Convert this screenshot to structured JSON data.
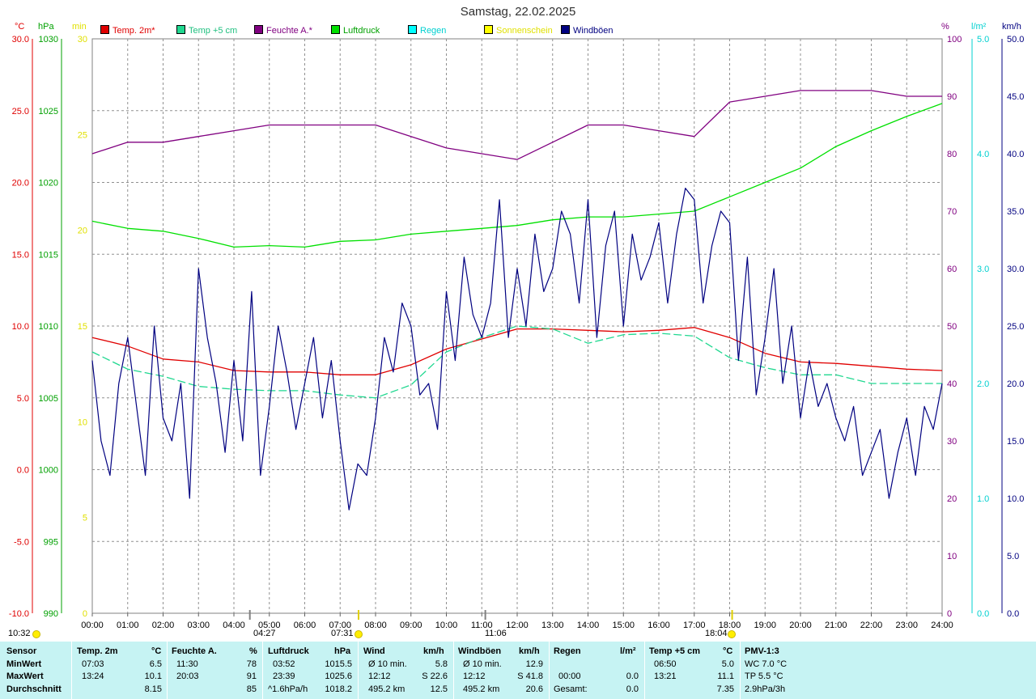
{
  "title": "Samstag, 22.02.2025",
  "axis_headers": {
    "degc": "°C",
    "hpa": "hPa",
    "min": "min",
    "pct": "%",
    "rain": "l/m²",
    "kmh": "km/h"
  },
  "legend": [
    {
      "label": "Temp. 2m*",
      "color": "#e00000",
      "text_color": "#e00000"
    },
    {
      "label": "Temp +5 cm",
      "color": "#20d890",
      "text_color": "#20c080"
    },
    {
      "label": "Feuchte A.*",
      "color": "#800080",
      "text_color": "#800080"
    },
    {
      "label": "Luftdruck",
      "color": "#00e000",
      "text_color": "#00a000"
    },
    {
      "label": "Regen",
      "color": "#00ffff",
      "text_color": "#00d0d0"
    },
    {
      "label": "Sonnenschein",
      "color": "#ffff00",
      "text_color": "#e0e000"
    },
    {
      "label": "Windböen",
      "color": "#000080",
      "text_color": "#000080"
    }
  ],
  "markers": {
    "sunrise": "07:31",
    "sunset": "18:04",
    "low_time": "04:27",
    "mid_time": "11:06",
    "top_left_time": "10:32"
  },
  "chart_data": {
    "type": "line",
    "title": "Samstag, 22.02.2025",
    "x_range_hours": [
      0,
      24
    ],
    "x_tick_labels": [
      "00:00",
      "01:00",
      "02:00",
      "03:00",
      "04:00",
      "05:00",
      "06:00",
      "07:00",
      "08:00",
      "09:00",
      "10:00",
      "11:00",
      "12:00",
      "13:00",
      "14:00",
      "15:00",
      "16:00",
      "17:00",
      "18:00",
      "19:00",
      "20:00",
      "21:00",
      "22:00",
      "23:00",
      "24:00"
    ],
    "axes": {
      "temp": {
        "unit": "°C",
        "range": [
          -10,
          30
        ],
        "ticks": [
          "-10.0",
          "-5.0",
          "0.0",
          "5.0",
          "10.0",
          "15.0",
          "20.0",
          "25.0",
          "30.0"
        ],
        "color": "#e00000"
      },
      "pressure": {
        "unit": "hPa",
        "range": [
          990,
          1030
        ],
        "ticks": [
          "990",
          "995",
          "1000",
          "1005",
          "1010",
          "1015",
          "1020",
          "1025",
          "1030"
        ],
        "color": "#00a000"
      },
      "sunshine": {
        "unit": "min",
        "range": [
          0,
          30
        ],
        "ticks": [
          "0",
          "5",
          "10",
          "15",
          "20",
          "25",
          "30"
        ],
        "color": "#e0e000"
      },
      "humidity": {
        "unit": "%",
        "range": [
          0,
          100
        ],
        "ticks": [
          "0",
          "10",
          "20",
          "30",
          "40",
          "50",
          "60",
          "70",
          "80",
          "90",
          "100"
        ],
        "color": "#800080"
      },
      "rain": {
        "unit": "l/m²",
        "range": [
          0,
          5
        ],
        "ticks": [
          "0.0",
          "1.0",
          "2.0",
          "3.0",
          "4.0",
          "5.0"
        ],
        "color": "#00d0d0"
      },
      "wind": {
        "unit": "km/h",
        "range": [
          0,
          50
        ],
        "ticks": [
          "0.0",
          "5.0",
          "10.0",
          "15.0",
          "20.0",
          "25.0",
          "30.0",
          "35.0",
          "40.0",
          "45.0",
          "50.0"
        ],
        "color": "#000080"
      }
    },
    "grid": true,
    "series": [
      {
        "name": "Temp. 2m*",
        "axis": "temp",
        "color": "#e00000",
        "x": [
          0,
          1,
          2,
          3,
          4,
          5,
          6,
          7,
          8,
          9,
          10,
          11,
          12,
          13,
          14,
          15,
          16,
          17,
          18,
          19,
          20,
          21,
          22,
          23,
          24
        ],
        "y": [
          9.2,
          8.6,
          7.7,
          7.5,
          6.9,
          6.8,
          6.8,
          6.6,
          6.6,
          7.3,
          8.4,
          9.1,
          9.8,
          9.8,
          9.7,
          9.6,
          9.7,
          9.9,
          9.2,
          8.1,
          7.5,
          7.4,
          7.2,
          7.0,
          6.9
        ]
      },
      {
        "name": "Temp +5 cm",
        "axis": "temp",
        "color": "#20d890",
        "x": [
          0,
          1,
          2,
          3,
          4,
          5,
          6,
          7,
          8,
          9,
          10,
          11,
          12,
          13,
          14,
          15,
          16,
          17,
          18,
          19,
          20,
          21,
          22,
          23,
          24
        ],
        "y": [
          8.2,
          7.0,
          6.5,
          5.8,
          5.6,
          5.5,
          5.5,
          5.2,
          5.0,
          5.9,
          8.2,
          9.2,
          10.0,
          9.8,
          8.8,
          9.4,
          9.5,
          9.3,
          7.8,
          7.1,
          6.6,
          6.6,
          6.0,
          6.0,
          6.0
        ]
      },
      {
        "name": "Feuchte A.*",
        "axis": "humidity",
        "color": "#800080",
        "x": [
          0,
          1,
          2,
          3,
          4,
          5,
          6,
          7,
          8,
          9,
          10,
          11,
          12,
          13,
          14,
          15,
          16,
          17,
          18,
          19,
          20,
          21,
          22,
          23,
          24
        ],
        "y": [
          80,
          82,
          82,
          83,
          84,
          85,
          85,
          85,
          85,
          83,
          81,
          80,
          79,
          82,
          85,
          85,
          84,
          83,
          89,
          90,
          91,
          91,
          91,
          90,
          90
        ]
      },
      {
        "name": "Luftdruck",
        "axis": "pressure",
        "color": "#00e000",
        "x": [
          0,
          1,
          2,
          3,
          4,
          5,
          6,
          7,
          8,
          9,
          10,
          11,
          12,
          13,
          14,
          15,
          16,
          17,
          18,
          19,
          20,
          21,
          22,
          23,
          24
        ],
        "y": [
          1017.3,
          1016.8,
          1016.6,
          1016.1,
          1015.5,
          1015.6,
          1015.5,
          1015.9,
          1016.0,
          1016.4,
          1016.6,
          1016.8,
          1017.0,
          1017.4,
          1017.6,
          1017.6,
          1017.8,
          1018.0,
          1019.0,
          1020.0,
          1021.0,
          1022.5,
          1023.6,
          1024.6,
          1025.5
        ]
      },
      {
        "name": "Windböen",
        "axis": "wind",
        "color": "#000080",
        "x": [
          0,
          0.25,
          0.5,
          0.75,
          1,
          1.25,
          1.5,
          1.75,
          2,
          2.25,
          2.5,
          2.75,
          3,
          3.25,
          3.5,
          3.75,
          4,
          4.25,
          4.5,
          4.75,
          5,
          5.25,
          5.5,
          5.75,
          6,
          6.25,
          6.5,
          6.75,
          7,
          7.25,
          7.5,
          7.75,
          8,
          8.25,
          8.5,
          8.75,
          9,
          9.25,
          9.5,
          9.75,
          10,
          10.25,
          10.5,
          10.75,
          11,
          11.25,
          11.5,
          11.75,
          12,
          12.25,
          12.5,
          12.75,
          13,
          13.25,
          13.5,
          13.75,
          14,
          14.25,
          14.5,
          14.75,
          15,
          15.25,
          15.5,
          15.75,
          16,
          16.25,
          16.5,
          16.75,
          17,
          17.25,
          17.5,
          17.75,
          18,
          18.25,
          18.5,
          18.75,
          19,
          19.25,
          19.5,
          19.75,
          20,
          20.25,
          20.5,
          20.75,
          21,
          21.25,
          21.5,
          21.75,
          22,
          22.25,
          22.5,
          22.75,
          23,
          23.25,
          23.5,
          23.75,
          24
        ],
        "y": [
          22,
          15,
          12,
          20,
          24,
          18,
          12,
          25,
          17,
          15,
          20,
          10,
          30,
          24,
          20,
          14,
          22,
          15,
          28,
          12,
          18,
          25,
          21,
          16,
          20,
          24,
          17,
          22,
          15,
          9,
          13,
          12,
          17,
          24,
          21,
          27,
          25,
          19,
          20,
          16,
          28,
          22,
          31,
          26,
          24,
          27,
          36,
          24,
          30,
          25,
          33,
          28,
          30,
          35,
          33,
          27,
          36,
          24,
          32,
          35,
          25,
          33,
          29,
          31,
          34,
          27,
          33,
          37,
          36,
          27,
          32,
          35,
          34,
          22,
          31,
          19,
          24,
          30,
          20,
          25,
          17,
          22,
          18,
          20,
          17,
          15,
          18,
          12,
          14,
          16,
          10,
          14,
          17,
          12,
          18,
          16,
          20
        ]
      }
    ]
  },
  "stats": {
    "headers": {
      "sensor": "Sensor",
      "temp2m": "Temp. 2m",
      "temp2m_unit": "°C",
      "hum": "Feuchte A.",
      "hum_unit": "%",
      "press": "Luftdruck",
      "press_unit": "hPa",
      "wind": "Wind",
      "wind_unit": "km/h",
      "gust": "Windböen",
      "gust_unit": "km/h",
      "rain": "Regen",
      "rain_unit": "l/m²",
      "t5": "Temp +5 cm",
      "t5_unit": "°C",
      "pmv": "PMV-1:3"
    },
    "row_labels": [
      "MinWert",
      "MaxWert",
      "Durchschnitt"
    ],
    "temp2m": [
      [
        "07:03",
        "6.5"
      ],
      [
        "13:24",
        "10.1"
      ],
      [
        "",
        "8.15"
      ]
    ],
    "hum": [
      [
        "11:30",
        "78"
      ],
      [
        "20:03",
        "91"
      ],
      [
        "",
        "85"
      ]
    ],
    "press": [
      [
        "03:52",
        "1015.5"
      ],
      [
        "23:39",
        "1025.6"
      ],
      [
        "^1.6hPa/h",
        "1018.2"
      ]
    ],
    "wind": [
      [
        "Ø 10 min.",
        "5.8"
      ],
      [
        "12:12",
        "S 22.6"
      ],
      [
        "495.2 km",
        "12.5"
      ]
    ],
    "gust": [
      [
        "Ø 10 min.",
        "12.9"
      ],
      [
        "12:12",
        "S 41.8"
      ],
      [
        "495.2 km",
        "20.6"
      ]
    ],
    "rain": [
      [
        "",
        ""
      ],
      [
        "00:00",
        "0.0"
      ],
      [
        "Gesamt:",
        "0.0"
      ]
    ],
    "t5": [
      [
        "06:50",
        "5.0"
      ],
      [
        "13:21",
        "11.1"
      ],
      [
        "",
        "7.35"
      ]
    ],
    "pmv": [
      "WC 7.0 °C",
      "TP 5.5 °C",
      "2.9hPa/3h"
    ]
  }
}
